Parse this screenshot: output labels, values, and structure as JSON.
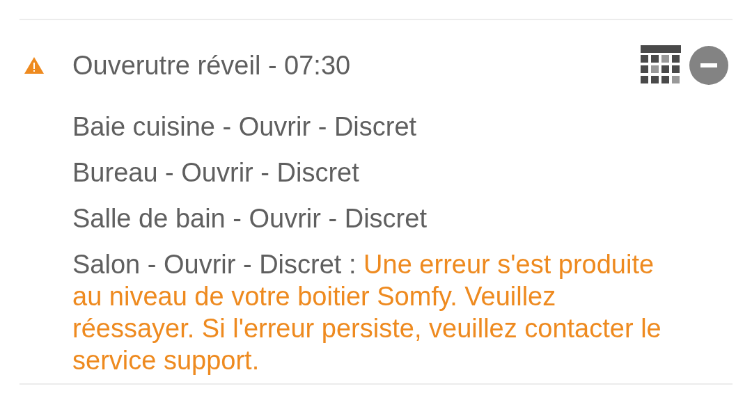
{
  "scenario": {
    "warning": true,
    "title": "Ouverutre réveil - 07:30",
    "actions": [
      {
        "text": "Baie cuisine - Ouvrir - Discret"
      },
      {
        "text": "Bureau - Ouvrir - Discret"
      },
      {
        "text": "Salle de bain - Ouvrir - Discret"
      },
      {
        "text": "Salon - Ouvrir - Discret :",
        "error": "Une erreur s'est produite au niveau de votre boitier Somfy. Veuillez réessayer. Si l'erreur persiste, veuillez contacter le service support."
      }
    ]
  }
}
